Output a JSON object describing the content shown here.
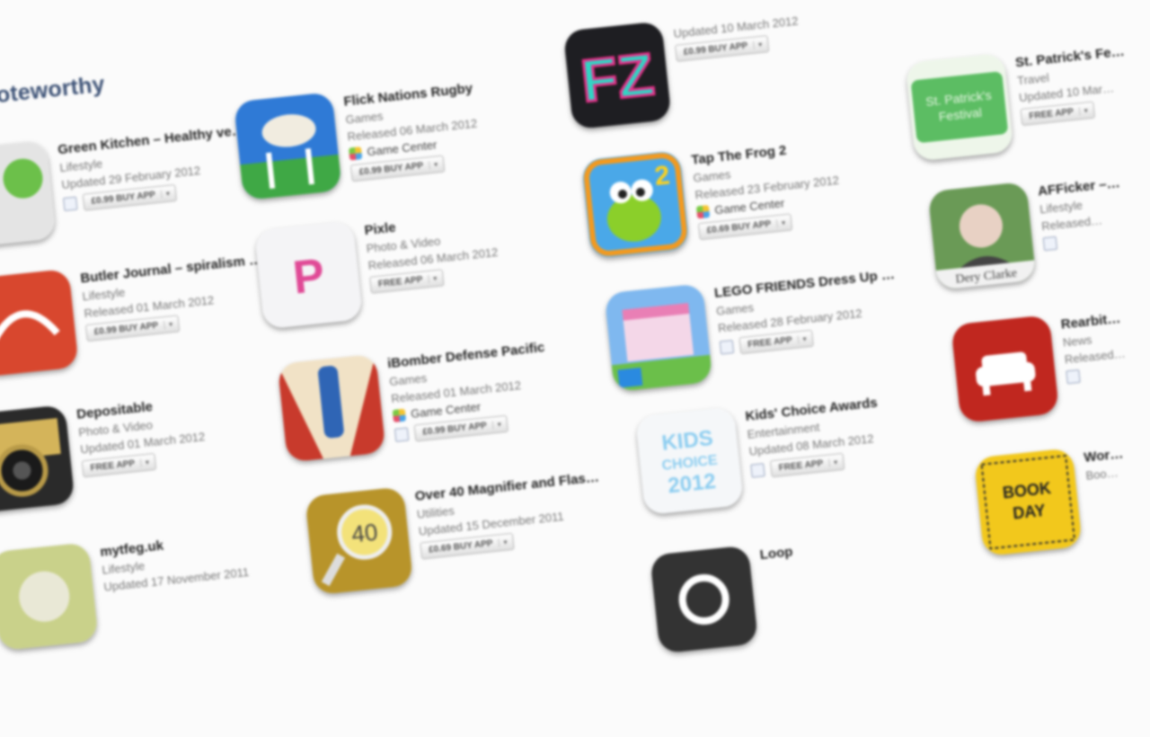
{
  "section": {
    "title": "Noteworthy"
  },
  "apps": [
    {
      "title": "Green Kitchen – Healthy veg…",
      "category": "Lifestyle",
      "date": "Updated 29 February 2012",
      "price": "£0.99 BUY APP",
      "gift": true,
      "icon": "green-kitchen-icon",
      "color": "#6cc04a"
    },
    {
      "title": "Butler Journal – spiralism an…",
      "category": "Lifestyle",
      "date": "Released 01 March 2012",
      "price": "£0.99 BUY APP",
      "icon": "journal-icon",
      "color": "#d8472e"
    },
    {
      "title": "Depositable",
      "category": "Photo & Video",
      "date": "Updated 01 March 2012",
      "price": "FREE APP",
      "icon": "camera-icon",
      "color": "#2a2a2a"
    },
    {
      "title": "mytfeg.uk",
      "category": "Lifestyle",
      "date": "Updated 17 November 2011",
      "price": "",
      "icon": "lifestyle-icon",
      "color": "#c9d18a"
    },
    {
      "title": "Flick Nations Rugby",
      "category": "Games",
      "date": "Released 06 March 2012",
      "game_center": "Game Center",
      "price": "£0.99 BUY APP",
      "icon": "rugby-icon",
      "color": "#2f7ad6"
    },
    {
      "title": "Pixle",
      "category": "Photo & Video",
      "date": "Released 06 March 2012",
      "price": "FREE APP",
      "icon": "pixle-icon",
      "color": "#e04a96"
    },
    {
      "title": "iBomber Defense Pacific",
      "category": "Games",
      "date": "Released 01 March 2012",
      "game_center": "Game Center",
      "price": "£0.99 BUY APP",
      "gift": true,
      "icon": "bomber-icon",
      "color": "#c83a2c"
    },
    {
      "title": "Over 40 Magnifier and Flashli…",
      "category": "Utilities",
      "date": "Updated 15 December 2011",
      "price": "£0.69 BUY APP",
      "icon": "magnifier-icon",
      "color": "#b8942a"
    },
    {
      "title": "",
      "category": "",
      "date": "Updated 10 March 2012",
      "price": "£0.99 BUY APP",
      "icon": "fz-icon",
      "color": "#1e1e22"
    },
    {
      "title": "Tap The Frog 2",
      "category": "Games",
      "date": "Released 23 February 2012",
      "game_center": "Game Center",
      "price": "£0.69 BUY APP",
      "icon": "frog-icon",
      "color": "#4aa8e8"
    },
    {
      "title": "LEGO FRIENDS Dress Up Ga…",
      "category": "Games",
      "date": "Released 28 February 2012",
      "price": "FREE APP",
      "gift": true,
      "icon": "lego-icon",
      "color": "#7fb8ef"
    },
    {
      "title": "Kids' Choice Awards",
      "category": "Entertainment",
      "date": "Updated 08 March 2012",
      "price": "FREE APP",
      "gift": true,
      "icon": "kids-choice-icon",
      "color": "#8ccdf0"
    },
    {
      "title": "Loop",
      "category": "",
      "date": "",
      "price": "",
      "icon": "loop-icon",
      "color": "#333333"
    },
    {
      "title": "St. Patrick's Fe…",
      "category": "Travel",
      "date": "Updated 10 Mar…",
      "price": "FREE APP",
      "icon": "shamrock-icon",
      "color": "#5cbd63"
    },
    {
      "title": "AFFicker –…",
      "category": "Lifestyle",
      "date": "Released…",
      "price": "",
      "gift": true,
      "icon": "portrait-icon",
      "color": "#6a9a56",
      "caption": "Dery Clarke"
    },
    {
      "title": "Rearbit…",
      "category": "News",
      "date": "Released…",
      "price": "",
      "gift": true,
      "icon": "sofa-icon",
      "color": "#c0271f"
    },
    {
      "title": "Wor…",
      "category": "Boo…",
      "date": "",
      "price": "",
      "icon": "book-icon",
      "color": "#f2c81c",
      "caption": "BOOK DAY"
    }
  ]
}
